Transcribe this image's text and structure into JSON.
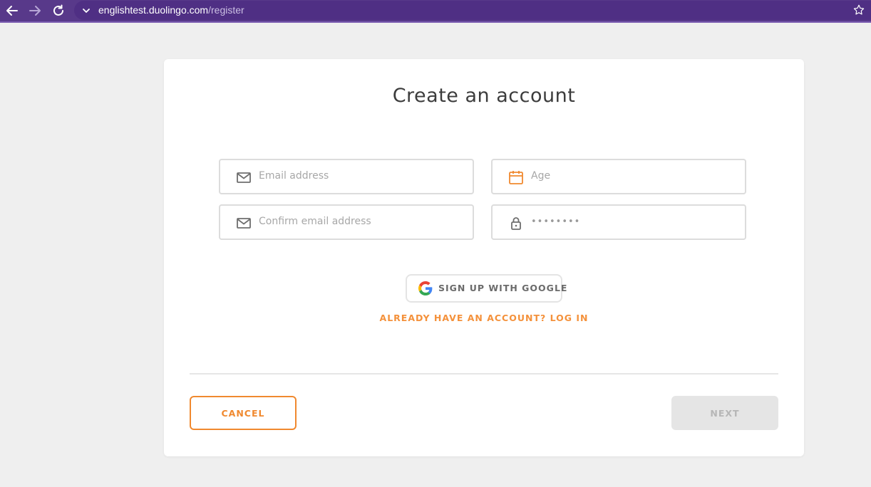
{
  "browser": {
    "url_host": "englishtest.duolingo.com",
    "url_path": "/register",
    "icons": [
      "back-arrow-icon",
      "forward-arrow-icon",
      "reload-icon",
      "chevron-down-icon",
      "star-icon"
    ],
    "colors": {
      "bar": "#58398a",
      "omnibox": "#4f2f84"
    }
  },
  "form": {
    "title": "Create an account",
    "email_placeholder": "Email address",
    "age_placeholder": "Age",
    "confirm_email_placeholder": "Confirm email address",
    "password_value": "••••••••",
    "google_button_label": "SIGN UP WITH GOOGLE",
    "login_link": "ALREADY HAVE AN ACCOUNT? LOG IN",
    "icons": [
      "envelope-icon",
      "calendar-icon",
      "lock-icon",
      "google-logo-icon"
    ]
  },
  "footer": {
    "cancel_label": "CANCEL",
    "next_label": "NEXT",
    "next_disabled": true
  },
  "colors": {
    "accent": "#f0892f",
    "disabled_bg": "#e5e5e5",
    "page_bg": "#efefef"
  }
}
